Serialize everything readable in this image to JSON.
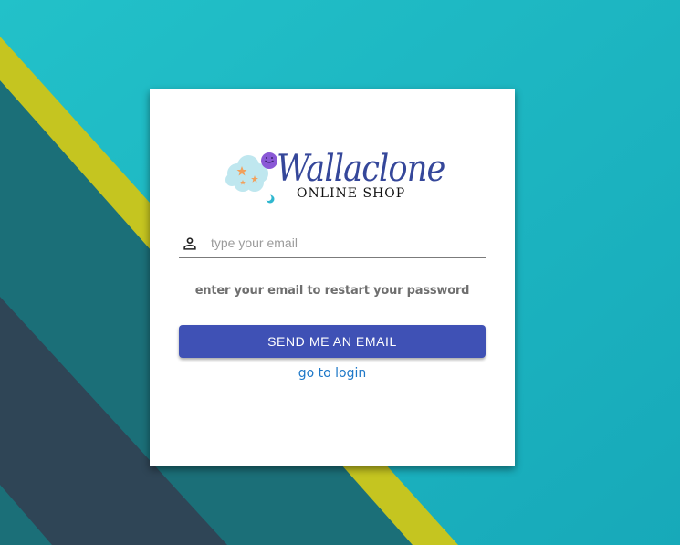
{
  "colors": {
    "background_teal": "#1fbcc7",
    "stripe_yellow": "#c5c520",
    "dark_teal": "#1b6f78",
    "slate": "#2f4556",
    "card": "#ffffff",
    "button": "#3f51b5",
    "link": "#1e78c8",
    "logo_text": "#35479a"
  },
  "logo": {
    "title": "Wallaclone",
    "subtitle": "ONLINE SHOP",
    "icon": "cloud-stars-icon"
  },
  "form": {
    "email_icon": "person-icon",
    "email_placeholder": "type your email",
    "email_value": "",
    "helper_text": "enter your email to restart your password",
    "submit_label": "SEND ME AN EMAIL",
    "login_link_label": "go to login"
  }
}
